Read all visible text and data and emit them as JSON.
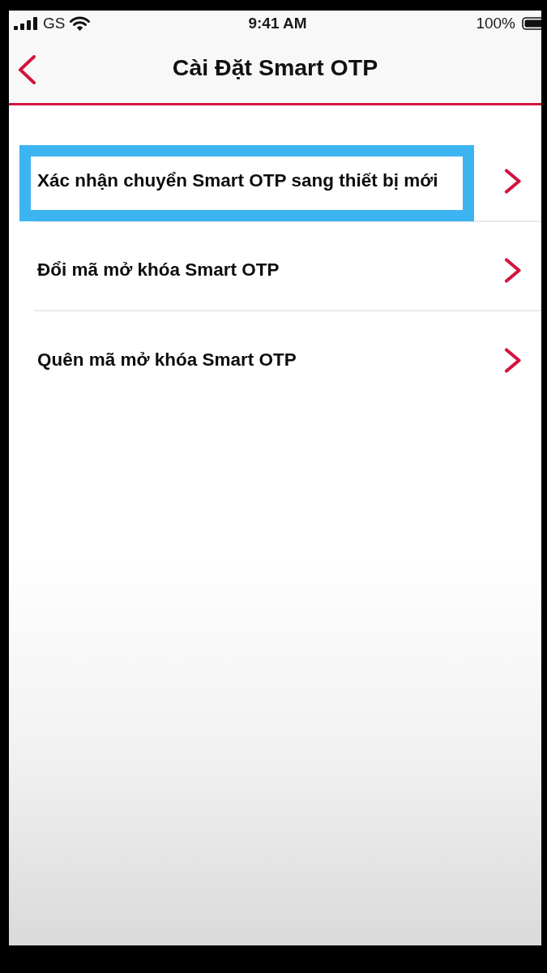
{
  "status_bar": {
    "carrier": "GS",
    "time": "9:41 AM",
    "battery": "100%"
  },
  "nav_bar": {
    "title": "Cài Đặt Smart OTP"
  },
  "menu_items": [
    {
      "label": "Xác nhận chuyển Smart OTP sang thiết bị mới",
      "highlighted": true
    },
    {
      "label": "Đổi mã mở khóa Smart OTP",
      "highlighted": false
    },
    {
      "label": "Quên mã mở khóa Smart OTP",
      "highlighted": false
    }
  ]
}
